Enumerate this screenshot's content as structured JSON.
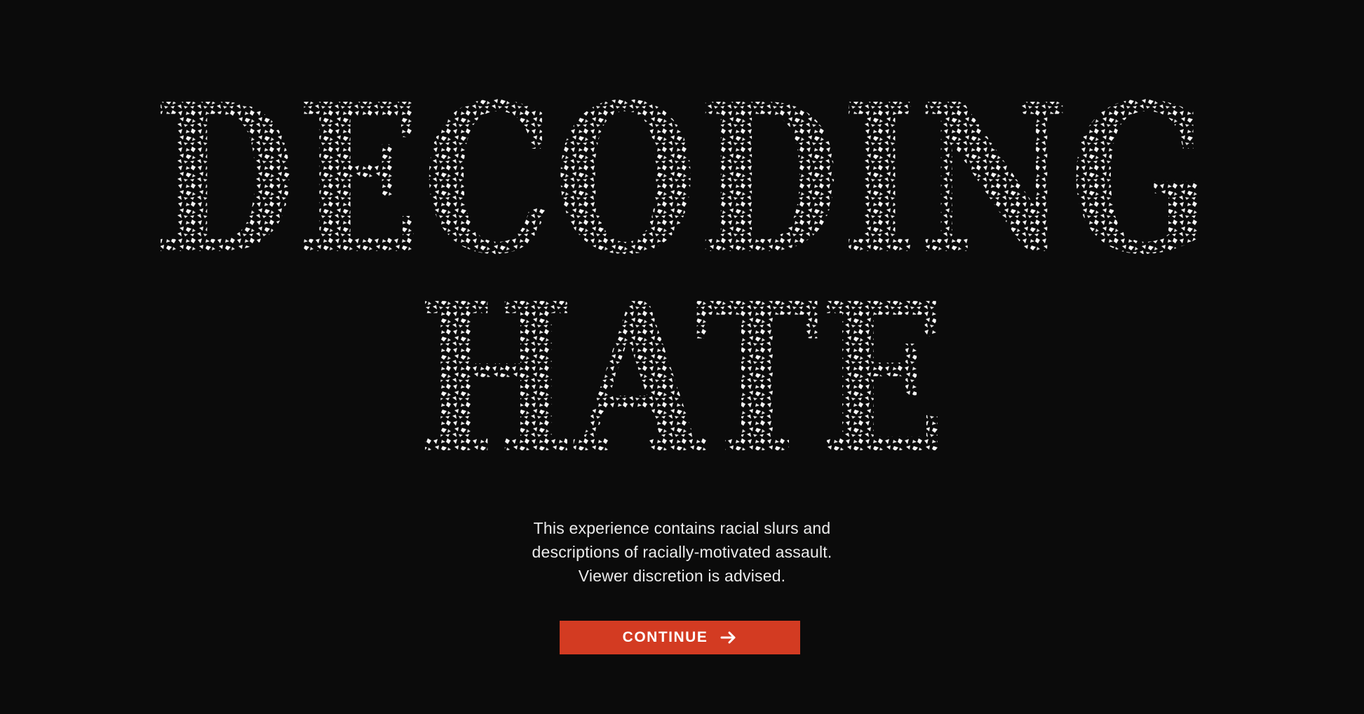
{
  "title": {
    "line1": "DECODING",
    "line2": "HATE"
  },
  "warning": {
    "line1": "This experience contains racial slurs and",
    "line2": "descriptions of racially-motivated assault.",
    "line3": "Viewer discretion is advised."
  },
  "continue_button": {
    "label": "CONTINUE",
    "icon": "arrow-right-icon"
  },
  "colors": {
    "background": "#0b0b0b",
    "title_texture": "#f2f2f2",
    "accent": "#d33b22",
    "body_text": "#ececec"
  }
}
